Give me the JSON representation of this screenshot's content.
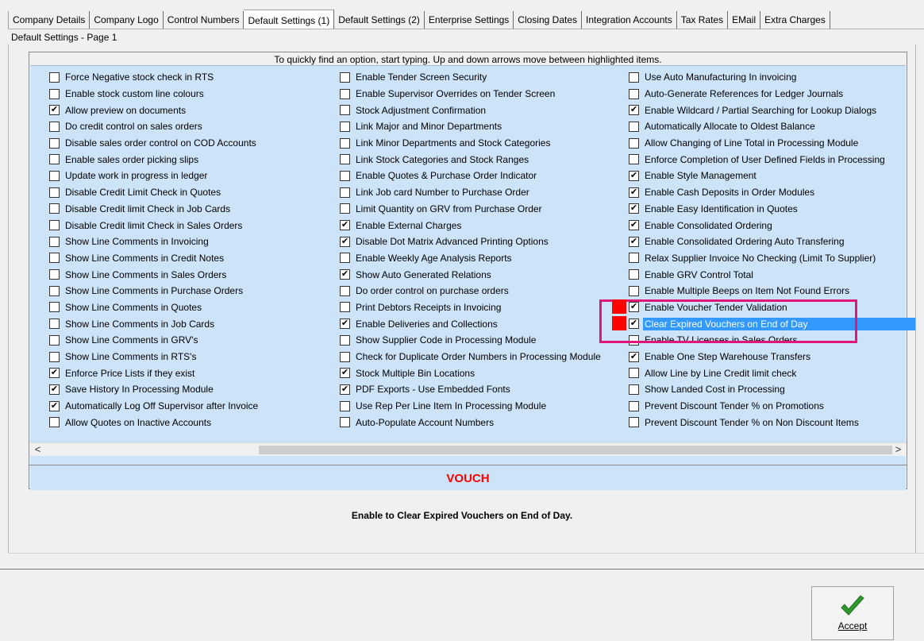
{
  "tabs": [
    {
      "label": "Company Details"
    },
    {
      "label": "Company Logo"
    },
    {
      "label": "Control Numbers"
    },
    {
      "label": "Default Settings (1)",
      "active": true
    },
    {
      "label": "Default Settings (2)"
    },
    {
      "label": "Enterprise Settings"
    },
    {
      "label": "Closing Dates"
    },
    {
      "label": "Integration Accounts"
    },
    {
      "label": "Tax Rates"
    },
    {
      "label": "EMail"
    },
    {
      "label": "Extra Charges"
    }
  ],
  "page_caption": "Default Settings - Page 1",
  "hint": "To quickly find an option, start typing. Up and down arrows move between highlighted items.",
  "columns": [
    [
      {
        "label": "Force Negative stock check in RTS",
        "checked": false
      },
      {
        "label": "Enable stock custom line colours",
        "checked": false
      },
      {
        "label": "Allow preview on documents",
        "checked": true
      },
      {
        "label": "Do credit control on sales orders",
        "checked": false
      },
      {
        "label": "Disable sales order control on COD Accounts",
        "checked": false
      },
      {
        "label": "Enable sales order picking slips",
        "checked": false
      },
      {
        "label": "Update work in progress in ledger",
        "checked": false
      },
      {
        "label": "Disable Credit Limit Check in Quotes",
        "checked": false
      },
      {
        "label": "Disable Credit limit Check in Job Cards",
        "checked": false
      },
      {
        "label": "Disable Credit limit Check in Sales Orders",
        "checked": false
      },
      {
        "label": "Show Line Comments in Invoicing",
        "checked": false
      },
      {
        "label": "Show Line Comments in Credit Notes",
        "checked": false
      },
      {
        "label": "Show Line Comments in Sales Orders",
        "checked": false
      },
      {
        "label": "Show Line Comments in Purchase Orders",
        "checked": false
      },
      {
        "label": "Show Line Comments in Quotes",
        "checked": false
      },
      {
        "label": "Show Line Comments in Job Cards",
        "checked": false
      },
      {
        "label": "Show Line Comments in GRV's",
        "checked": false
      },
      {
        "label": "Show Line Comments in RTS's",
        "checked": false
      },
      {
        "label": "Enforce Price Lists if they exist",
        "checked": true
      },
      {
        "label": "Save History In Processing Module",
        "checked": true
      },
      {
        "label": "Automatically Log Off Supervisor after Invoice",
        "checked": true
      },
      {
        "label": "Allow Quotes on Inactive Accounts",
        "checked": false
      }
    ],
    [
      {
        "label": "Enable Tender Screen Security",
        "checked": false
      },
      {
        "label": "Enable Supervisor Overrides on Tender Screen",
        "checked": false
      },
      {
        "label": "Stock Adjustment Confirmation",
        "checked": false
      },
      {
        "label": "Link Major and Minor Departments",
        "checked": false
      },
      {
        "label": "Link Minor Departments and Stock Categories",
        "checked": false
      },
      {
        "label": "Link Stock Categories and Stock Ranges",
        "checked": false
      },
      {
        "label": "Enable Quotes & Purchase Order Indicator",
        "checked": false
      },
      {
        "label": "Link Job card Number to Purchase Order",
        "checked": false
      },
      {
        "label": "Limit Quantity on GRV from Purchase Order",
        "checked": false
      },
      {
        "label": "Enable External Charges",
        "checked": true
      },
      {
        "label": "Disable Dot Matrix Advanced Printing Options",
        "checked": true
      },
      {
        "label": "Enable Weekly Age Analysis Reports",
        "checked": false
      },
      {
        "label": "Show Auto Generated Relations",
        "checked": true
      },
      {
        "label": "Do order control on purchase orders",
        "checked": false
      },
      {
        "label": "Print Debtors Receipts in Invoicing",
        "checked": false
      },
      {
        "label": "Enable Deliveries and Collections",
        "checked": true
      },
      {
        "label": "Show Supplier Code in Processing Module",
        "checked": false
      },
      {
        "label": "Check for Duplicate Order Numbers in Processing Module",
        "checked": false
      },
      {
        "label": "Stock Multiple Bin Locations",
        "checked": true
      },
      {
        "label": "PDF Exports - Use Embedded Fonts",
        "checked": true
      },
      {
        "label": "Use Rep Per Line Item In Processing Module",
        "checked": false
      },
      {
        "label": "Auto-Populate Account Numbers",
        "checked": false
      }
    ],
    [
      {
        "label": "Use Auto Manufacturing In invoicing",
        "checked": false
      },
      {
        "label": "Auto-Generate References for Ledger Journals",
        "checked": false
      },
      {
        "label": "Enable Wildcard / Partial Searching for Lookup Dialogs",
        "checked": true
      },
      {
        "label": "Automatically Allocate to Oldest Balance",
        "checked": false
      },
      {
        "label": "Allow Changing of Line Total in Processing Module",
        "checked": false
      },
      {
        "label": "Enforce Completion of User Defined Fields in Processing",
        "checked": false
      },
      {
        "label": "Enable Style Management",
        "checked": true
      },
      {
        "label": "Enable Cash Deposits in Order Modules",
        "checked": true
      },
      {
        "label": "Enable Easy Identification in Quotes",
        "checked": true
      },
      {
        "label": "Enable Consolidated Ordering",
        "checked": true
      },
      {
        "label": "Enable Consolidated Ordering Auto Transfering",
        "checked": true
      },
      {
        "label": "Relax Supplier Invoice No Checking (Limit To Supplier)",
        "checked": false
      },
      {
        "label": "Enable GRV Control Total",
        "checked": false
      },
      {
        "label": "Enable Multiple Beeps on Item Not Found Errors",
        "checked": false
      },
      {
        "label": "Enable Voucher Tender Validation",
        "checked": true,
        "marked": true
      },
      {
        "label": "Clear Expired Vouchers on End of Day",
        "checked": true,
        "marked": true,
        "selected": true
      },
      {
        "label": "Enable TV Licenses in Sales Orders",
        "checked": false
      },
      {
        "label": "Enable One Step Warehouse Transfers",
        "checked": true
      },
      {
        "label": "Allow Line by Line Credit limit check",
        "checked": false
      },
      {
        "label": "Show Landed Cost in Processing",
        "checked": false
      },
      {
        "label": "Prevent Discount Tender % on Promotions",
        "checked": false
      },
      {
        "label": "Prevent Discount Tender % on Non Discount Items",
        "checked": false
      }
    ]
  ],
  "scrollbar": {
    "left_arrow": "<",
    "right_arrow": ">"
  },
  "search_text": "VOUCH",
  "description": "Enable to Clear Expired Vouchers on End of Day.",
  "accept_label": "Accept",
  "colors": {
    "accent": "#3399ff",
    "search": "#ff0000",
    "highlight": "#e0157b",
    "grid_bg": "#cde3f7"
  }
}
